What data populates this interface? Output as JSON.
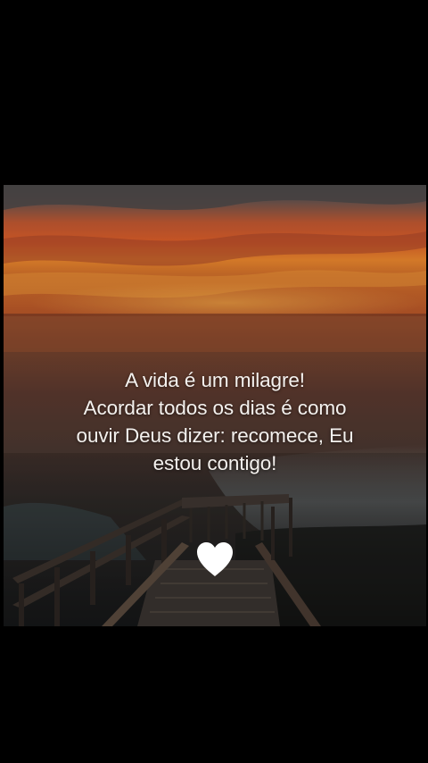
{
  "quote": {
    "lines": [
      "A vida é um milagre!",
      "Acordar todos os dias é como",
      "ouvir Deus dizer: recomece, Eu",
      "estou contigo!"
    ]
  },
  "icons": {
    "heart": "heart-icon"
  },
  "colors": {
    "background": "#000000",
    "text": "#f4f1ee",
    "heart": "#ffffff",
    "sunset_orange": "#e0592a",
    "sea": "#3b3f44"
  }
}
